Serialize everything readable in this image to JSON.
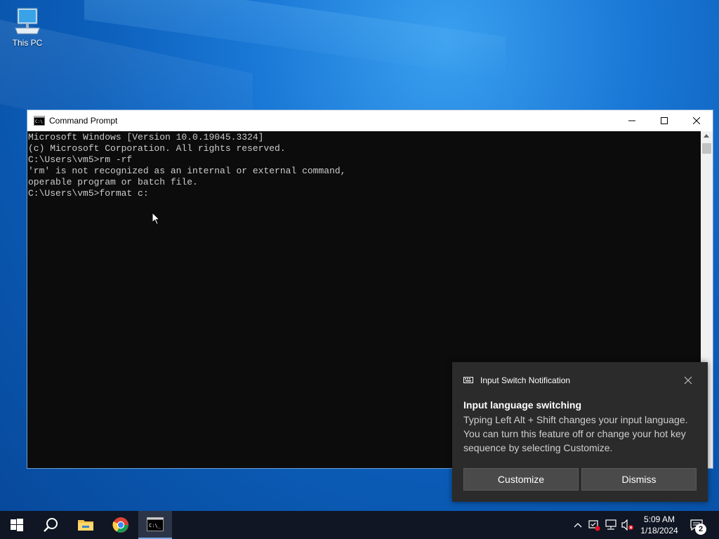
{
  "desktop": {
    "icons": [
      {
        "label": "This PC",
        "icon": "computer-icon"
      }
    ]
  },
  "cmd": {
    "title": "Command Prompt",
    "lines": [
      "Microsoft Windows [Version 10.0.19045.3324]",
      "(c) Microsoft Corporation. All rights reserved.",
      "",
      "C:\\Users\\vm5>rm -rf",
      "'rm' is not recognized as an internal or external command,",
      "operable program or batch file.",
      "",
      "C:\\Users\\vm5>format c:"
    ],
    "controls": {
      "minimize": "minimize-icon",
      "maximize": "maximize-icon",
      "close": "close-icon"
    }
  },
  "toast": {
    "app_name": "Input Switch Notification",
    "title": "Input language switching",
    "body": "Typing Left Alt + Shift changes your input language. You can turn this feature off or change your hot key sequence by selecting Customize.",
    "buttons": {
      "customize": "Customize",
      "dismiss": "Dismiss"
    }
  },
  "taskbar": {
    "items": [
      "start-icon",
      "search-icon",
      "file-explorer-icon",
      "chrome-icon",
      "command-prompt-icon"
    ],
    "tray": [
      "chevron-up-icon",
      "security-icon",
      "network-icon",
      "volume-muted-icon"
    ],
    "time": "5:09 AM",
    "date": "1/18/2024",
    "notification_count": "2"
  }
}
